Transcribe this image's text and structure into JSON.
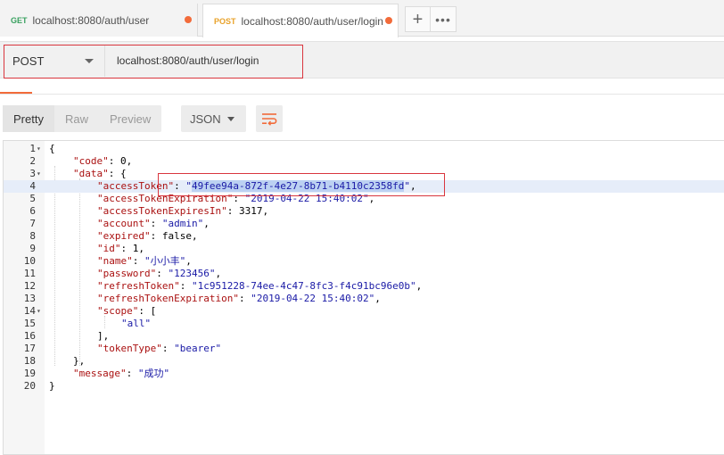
{
  "tabs": [
    {
      "method": "GET",
      "url": "localhost:8080/auth/user",
      "modified": true
    },
    {
      "method": "POST",
      "url": "localhost:8080/auth/user/login",
      "modified": true
    }
  ],
  "tab_actions": {
    "new_tab": "+",
    "more": "•••"
  },
  "request": {
    "method": "POST",
    "url": "localhost:8080/auth/user/login"
  },
  "response_view": {
    "modes": [
      "Pretty",
      "Raw",
      "Preview"
    ],
    "active_mode": "Pretty",
    "format": "JSON"
  },
  "colors": {
    "accent": "#f26b3a",
    "annotation": "#d9363e",
    "json_key": "#aa1111",
    "json_string": "#1a1aa6",
    "selection": "#bcd1f2"
  },
  "code_lines": [
    {
      "n": "1",
      "fold": true,
      "text": "{"
    },
    {
      "n": "2",
      "fold": false,
      "key": "\"code\"",
      "sep": ": ",
      "val": "0",
      "tail": ","
    },
    {
      "n": "3",
      "fold": true,
      "key": "\"data\"",
      "sep": ": ",
      "val": "{",
      "tail": ""
    },
    {
      "n": "4",
      "fold": false,
      "key": "\"accessToken\"",
      "sep": ": ",
      "q1": "\"",
      "sel": "49fee94a-872f-4e27-8b71-b4110c2358fd",
      "q2": "\"",
      "tail": ","
    },
    {
      "n": "5",
      "fold": false,
      "key": "\"accessTokenExpiration\"",
      "sep": ": ",
      "val": "\"2019-04-22 15:40:02\"",
      "tail": ","
    },
    {
      "n": "6",
      "fold": false,
      "key": "\"accessTokenExpiresIn\"",
      "sep": ": ",
      "val": "3317",
      "tail": ","
    },
    {
      "n": "7",
      "fold": false,
      "key": "\"account\"",
      "sep": ": ",
      "val": "\"admin\"",
      "tail": ","
    },
    {
      "n": "8",
      "fold": false,
      "key": "\"expired\"",
      "sep": ": ",
      "val": "false",
      "tail": ","
    },
    {
      "n": "9",
      "fold": false,
      "key": "\"id\"",
      "sep": ": ",
      "val": "1",
      "tail": ","
    },
    {
      "n": "10",
      "fold": false,
      "key": "\"name\"",
      "sep": ": ",
      "val": "\"小小丰\"",
      "tail": ","
    },
    {
      "n": "11",
      "fold": false,
      "key": "\"password\"",
      "sep": ": ",
      "val": "\"123456\"",
      "tail": ","
    },
    {
      "n": "12",
      "fold": false,
      "key": "\"refreshToken\"",
      "sep": ": ",
      "val": "\"1c951228-74ee-4c47-8fc3-f4c91bc96e0b\"",
      "tail": ","
    },
    {
      "n": "13",
      "fold": false,
      "key": "\"refreshTokenExpiration\"",
      "sep": ": ",
      "val": "\"2019-04-22 15:40:02\"",
      "tail": ","
    },
    {
      "n": "14",
      "fold": true,
      "key": "\"scope\"",
      "sep": ": ",
      "val": "[",
      "tail": ""
    },
    {
      "n": "15",
      "fold": false,
      "val": "\"all\"",
      "tail": ""
    },
    {
      "n": "16",
      "fold": false,
      "text": "],"
    },
    {
      "n": "17",
      "fold": false,
      "key": "\"tokenType\"",
      "sep": ": ",
      "val": "\"bearer\"",
      "tail": ""
    },
    {
      "n": "18",
      "fold": false,
      "text": "},"
    },
    {
      "n": "19",
      "fold": false,
      "key": "\"message\"",
      "sep": ": ",
      "val": "\"成功\"",
      "tail": ""
    },
    {
      "n": "20",
      "fold": false,
      "text": "}"
    }
  ]
}
